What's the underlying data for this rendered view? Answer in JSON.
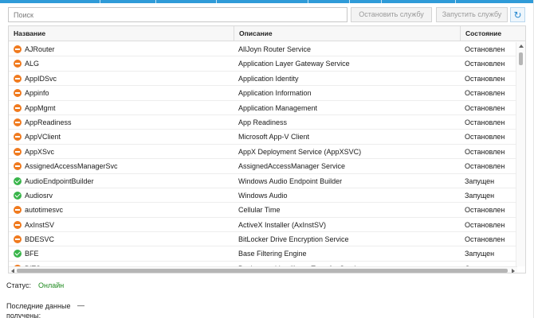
{
  "toolbar": {
    "search_placeholder": "Поиск",
    "stop_label": "Остановить службу",
    "start_label": "Запустить службу",
    "refresh_icon": "refresh-icon"
  },
  "table": {
    "columns": [
      "Название",
      "Описание",
      "Состояние"
    ],
    "rows": [
      {
        "name": "AJRouter",
        "description": "AllJoyn Router Service",
        "state": "Остановлен",
        "icon": "stopped"
      },
      {
        "name": "ALG",
        "description": "Application Layer Gateway Service",
        "state": "Остановлен",
        "icon": "stopped"
      },
      {
        "name": "AppIDSvc",
        "description": "Application Identity",
        "state": "Остановлен",
        "icon": "stopped"
      },
      {
        "name": "Appinfo",
        "description": "Application Information",
        "state": "Остановлен",
        "icon": "stopped"
      },
      {
        "name": "AppMgmt",
        "description": "Application Management",
        "state": "Остановлен",
        "icon": "stopped"
      },
      {
        "name": "AppReadiness",
        "description": "App Readiness",
        "state": "Остановлен",
        "icon": "stopped"
      },
      {
        "name": "AppVClient",
        "description": "Microsoft App-V Client",
        "state": "Остановлен",
        "icon": "stopped"
      },
      {
        "name": "AppXSvc",
        "description": "AppX Deployment Service (AppXSVC)",
        "state": "Остановлен",
        "icon": "stopped"
      },
      {
        "name": "AssignedAccessManagerSvc",
        "description": "AssignedAccessManager Service",
        "state": "Остановлен",
        "icon": "stopped"
      },
      {
        "name": "AudioEndpointBuilder",
        "description": "Windows Audio Endpoint Builder",
        "state": "Запущен",
        "icon": "running"
      },
      {
        "name": "Audiosrv",
        "description": "Windows Audio",
        "state": "Запущен",
        "icon": "running"
      },
      {
        "name": "autotimesvc",
        "description": "Cellular Time",
        "state": "Остановлен",
        "icon": "stopped"
      },
      {
        "name": "AxInstSV",
        "description": "ActiveX Installer (AxInstSV)",
        "state": "Остановлен",
        "icon": "stopped"
      },
      {
        "name": "BDESVC",
        "description": "BitLocker Drive Encryption Service",
        "state": "Остановлен",
        "icon": "stopped"
      },
      {
        "name": "BFE",
        "description": "Base Filtering Engine",
        "state": "Запущен",
        "icon": "running"
      },
      {
        "name": "BITS",
        "description": "Background Intelligent Transfer Service",
        "state": "Остановлен",
        "icon": "stopped"
      }
    ]
  },
  "status": {
    "label": "Статус:",
    "value": "Онлайн"
  },
  "last_data": {
    "label": "Последние данные получены:",
    "value": "—"
  },
  "colors": {
    "accent": "#2f9bd8",
    "stopped": "#f07a1e",
    "running": "#39b54a",
    "online": "#1f8a1f"
  }
}
